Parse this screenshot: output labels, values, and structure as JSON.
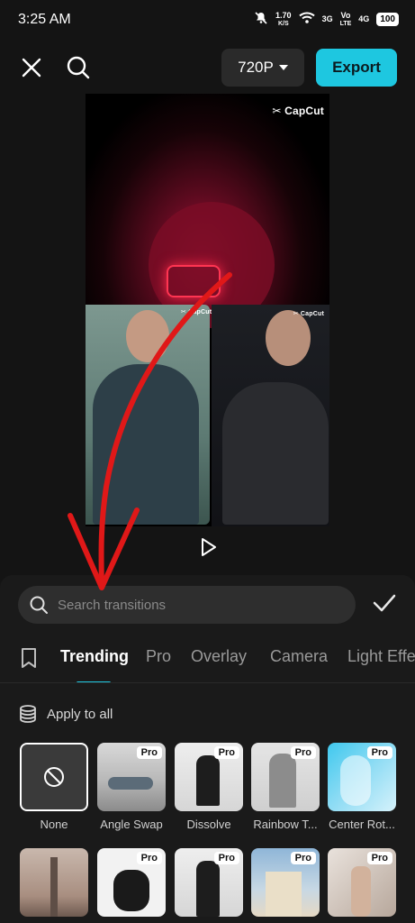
{
  "status": {
    "time": "3:25 AM",
    "speed_value": "1.70",
    "speed_unit": "K/S",
    "net1": "3G",
    "volte_top": "Vo",
    "volte_bottom": "LTE",
    "net2": "4G",
    "battery": "100"
  },
  "toolbar": {
    "resolution": "720P",
    "export_label": "Export"
  },
  "preview": {
    "watermark_main": "✂ CapCut",
    "watermark_small": "✂ CapCut"
  },
  "search": {
    "placeholder": "Search transitions"
  },
  "tabs": [
    "Trending",
    "Pro",
    "Overlay",
    "Camera",
    "Light Effe"
  ],
  "apply_all_label": "Apply to all",
  "transitions": [
    {
      "label": "None",
      "pro": false
    },
    {
      "label": "Angle Swap",
      "pro": true,
      "badge": "Pro"
    },
    {
      "label": "Dissolve",
      "pro": true,
      "badge": "Pro"
    },
    {
      "label": "Rainbow T...",
      "pro": true,
      "badge": "Pro"
    },
    {
      "label": "Center Rot...",
      "pro": true,
      "badge": "Pro"
    },
    {
      "label": "",
      "pro": false
    },
    {
      "label": "",
      "pro": true,
      "badge": "Pro"
    },
    {
      "label": "",
      "pro": true,
      "badge": "Pro"
    },
    {
      "label": "",
      "pro": true,
      "badge": "Pro"
    },
    {
      "label": "",
      "pro": true,
      "badge": "Pro"
    }
  ],
  "colors": {
    "accent": "#1ec7e0",
    "annotation_arrow": "#e01818"
  }
}
